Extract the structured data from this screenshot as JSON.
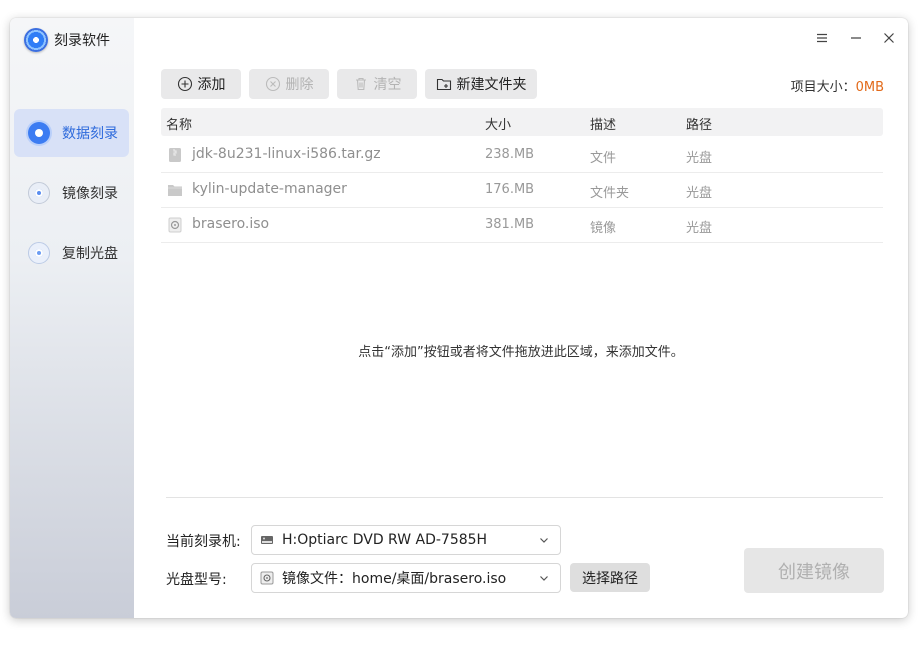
{
  "app": {
    "title": "刻录软件"
  },
  "sidebar": {
    "items": [
      {
        "label": "数据刻录",
        "icon": "disc-data-icon",
        "active": true
      },
      {
        "label": "镜像刻录",
        "icon": "disc-image-icon",
        "active": false
      },
      {
        "label": "复制光盘",
        "icon": "disc-copy-icon",
        "active": false
      }
    ]
  },
  "window_controls": {
    "menu": "☰",
    "minimize": "—",
    "close": "✕"
  },
  "toolbar": {
    "add_label": "添加",
    "delete_label": "删除",
    "clear_label": "清空",
    "new_folder_label": "新建文件夹"
  },
  "project_size": {
    "label": "项目大小：",
    "value": "0MB"
  },
  "table": {
    "columns": [
      "名称",
      "大小",
      "描述",
      "路径"
    ],
    "rows": [
      {
        "name": "jdk-8u231-linux-i586.tar.gz",
        "size": "238.MB",
        "desc": "文件",
        "path": "光盘",
        "icon": "archive-file-icon"
      },
      {
        "name": "kylin-update-manager",
        "size": "176.MB",
        "desc": "文件夹",
        "path": "光盘",
        "icon": "folder-icon"
      },
      {
        "name": "brasero.iso",
        "size": "381.MB",
        "desc": "镜像",
        "path": "光盘",
        "icon": "iso-file-icon"
      }
    ]
  },
  "hint": "点击“添加”按钮或者将文件拖放进此区域，来添加文件。",
  "burner": {
    "label": "当前刻录机:",
    "value": "H:Optiarc DVD RW AD-7585H"
  },
  "disc_type": {
    "label": "光盘型号:",
    "value": "镜像文件：home/桌面/brasero.iso"
  },
  "select_path_label": "选择路径",
  "create_label": "创建镜像",
  "colors": {
    "accent": "#2f6bdc",
    "active_bg": "#d8e1f7",
    "size_value": "#e26a1a"
  }
}
